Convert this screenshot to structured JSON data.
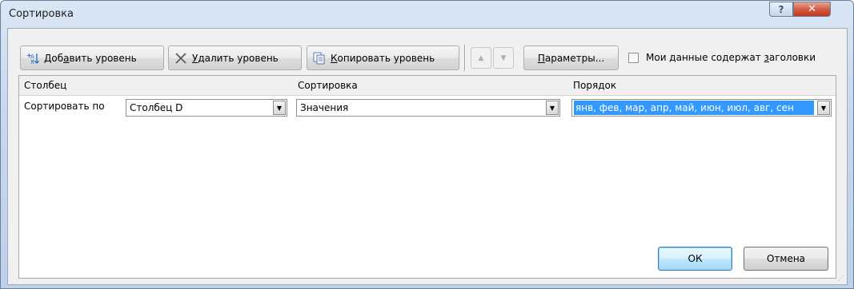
{
  "window": {
    "title": "Сортировка",
    "help_glyph": "?",
    "close_glyph": "✕"
  },
  "toolbar": {
    "add_level": {
      "pre": "Доб",
      "key": "а",
      "post": "вить уровень",
      "icon": "add-sort-level-icon"
    },
    "delete_level": {
      "pre": "",
      "key": "У",
      "post": "далить уровень",
      "icon": "delete-x-icon"
    },
    "copy_level": {
      "pre": "",
      "key": "К",
      "post": "опировать уровень",
      "icon": "copy-icon"
    },
    "move_up_glyph": "▲",
    "move_down_glyph": "▼",
    "options": {
      "pre": "",
      "key": "П",
      "post": "араметры...",
      "icon": ""
    },
    "headers_checkbox": {
      "pre": "Мои данные содержат ",
      "key": "з",
      "post": "аголовки",
      "checked": false
    }
  },
  "grid": {
    "headers": {
      "column": "Столбец",
      "sort_on": "Сортировка",
      "order": "Порядок"
    },
    "rows": [
      {
        "label": "Сортировать по",
        "column": "Столбец D",
        "sort_on": "Значения",
        "order": "янв, фев, мар, апр, май, июн, июл, авг, сен"
      }
    ]
  },
  "footer": {
    "ok": "ОК",
    "cancel": "Отмена"
  },
  "colors": {
    "selection": "#3399ff",
    "close_button": "#c1381f",
    "title_gradient_top": "#d9e6f4"
  }
}
